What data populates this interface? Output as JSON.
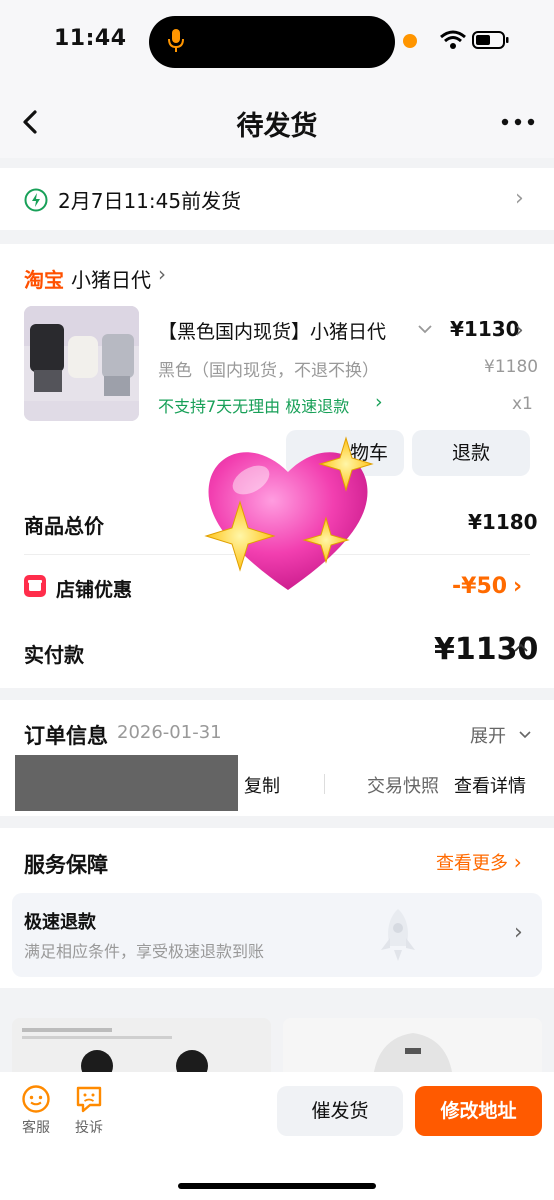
{
  "status": {
    "time": "11:44"
  },
  "nav": {
    "title": "待发货"
  },
  "shipping": {
    "deadline": "2月7日11:45前发货"
  },
  "order": {
    "shop_logo": "淘宝",
    "shop_name": "小猪日代",
    "product": {
      "title": "【黑色国内现货】小猪日代",
      "price": "¥1130",
      "sku": "黑色（国内现货，不退不换）",
      "original_price": "¥1180",
      "tags": "不支持7天无理由  极速退款",
      "quantity": "x1"
    },
    "buttons": {
      "cart": "物车",
      "refund": "退款"
    },
    "summary": {
      "total_label": "商品总价",
      "total_value": "¥1180",
      "discount_label": "店铺优惠",
      "discount_value": "-¥50",
      "paid_label": "实付款",
      "paid_value": "¥1130"
    }
  },
  "order_info": {
    "title": "订单信息",
    "date": "2026-01-31",
    "expand": "展开",
    "copy": "复制",
    "snapshot": "交易快照",
    "detail": "查看详情"
  },
  "service": {
    "title": "服务保障",
    "more": "查看更多",
    "item_title": "极速退款",
    "item_desc": "满足相应条件，享受极速退款到账"
  },
  "bottom": {
    "service_label": "客服",
    "complain_label": "投诉",
    "urge_label": "催发货",
    "address_label": "修改地址"
  },
  "colors": {
    "accent": "#ff5000",
    "green": "#18a058",
    "discount": "#ff6a00"
  }
}
